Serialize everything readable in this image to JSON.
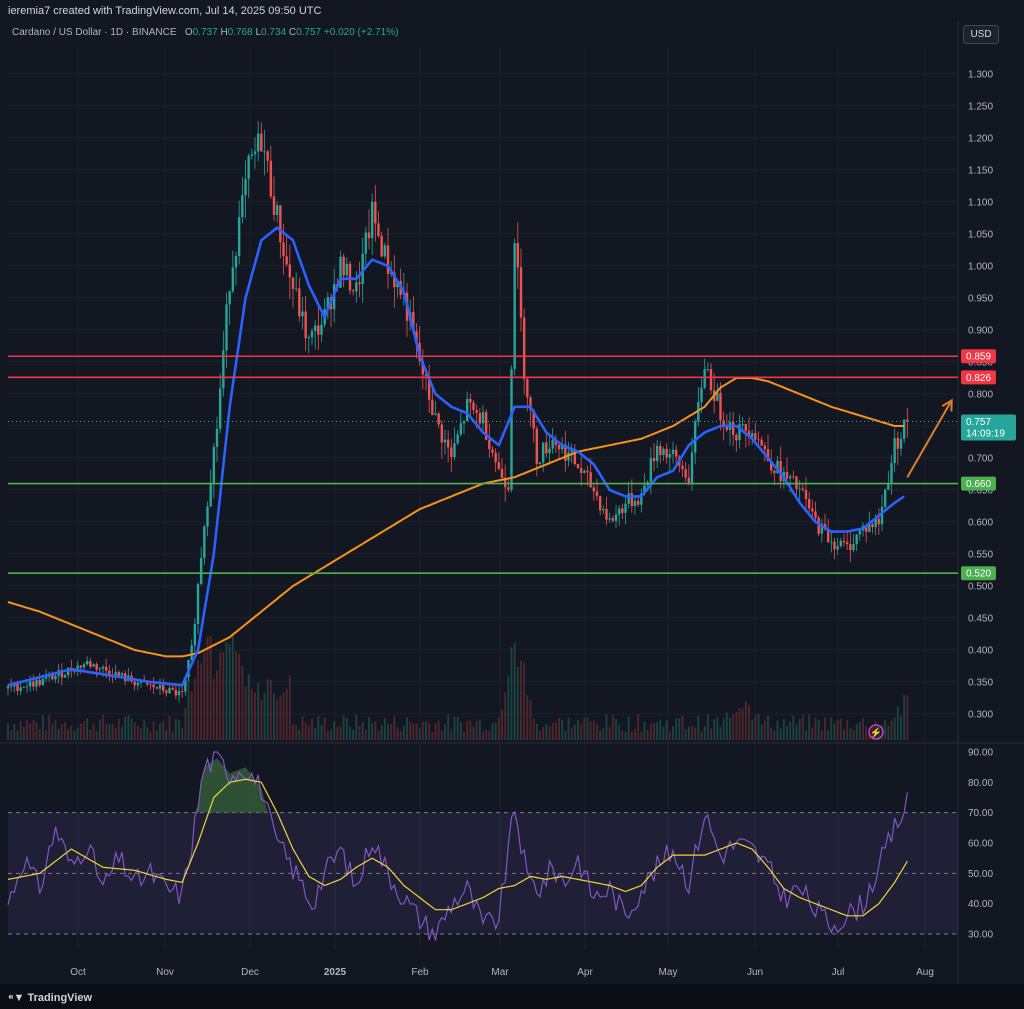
{
  "header": {
    "credit": "ieremia7 created with TradingView.com, Jul 14, 2025 09:50 UTC"
  },
  "legend": {
    "symbol": "Cardano / US Dollar · 1D · BINANCE",
    "open_label": "O",
    "open": "0.737",
    "high_label": "H",
    "high": "0.768",
    "low_label": "L",
    "low": "0.734",
    "close_label": "C",
    "close": "0.757",
    "change": "+0.020 (+2.71%)"
  },
  "currency_button": "USD",
  "footer": {
    "brand": "TradingView"
  },
  "colors": {
    "background": "#131722",
    "up": "#26a69a",
    "down": "#ef5350",
    "ema_fast": "#2962ff",
    "ema_slow": "#f7931a",
    "resistance": "#f23645",
    "support": "#4caf50",
    "rsi": "#7e57c2",
    "rsi_ma": "#f0d43a",
    "arrow": "#d9822b"
  },
  "chart_data": [
    {
      "type": "candlestick",
      "title": "Cardano / US Dollar · 1D · BINANCE",
      "x_labels": [
        "Oct",
        "Nov",
        "Dec",
        "2025",
        "Feb",
        "Mar",
        "Apr",
        "May",
        "Jun",
        "Jul",
        "Aug"
      ],
      "y_ticks": [
        "0.300",
        "0.350",
        "0.400",
        "0.450",
        "0.500",
        "0.550",
        "0.600",
        "0.650",
        "0.700",
        "0.750",
        "0.800",
        "0.850",
        "0.900",
        "0.950",
        "1.000",
        "1.050",
        "1.100",
        "1.150",
        "1.200",
        "1.250",
        "1.300"
      ],
      "ylim": [
        0.27,
        1.33
      ],
      "price_anchors": [
        [
          0,
          0.34
        ],
        [
          10,
          0.35
        ],
        [
          25,
          0.38
        ],
        [
          40,
          0.35
        ],
        [
          55,
          0.33
        ],
        [
          58,
          0.4
        ],
        [
          62,
          0.6
        ],
        [
          66,
          0.75
        ],
        [
          70,
          0.98
        ],
        [
          76,
          1.15
        ],
        [
          80,
          1.2
        ],
        [
          84,
          1.1
        ],
        [
          88,
          1.0
        ],
        [
          95,
          0.88
        ],
        [
          100,
          0.92
        ],
        [
          105,
          1.0
        ],
        [
          110,
          0.96
        ],
        [
          115,
          1.08
        ],
        [
          120,
          1.0
        ],
        [
          125,
          0.95
        ],
        [
          130,
          0.85
        ],
        [
          135,
          0.76
        ],
        [
          140,
          0.7
        ],
        [
          145,
          0.78
        ],
        [
          150,
          0.76
        ],
        [
          155,
          0.68
        ],
        [
          158,
          0.66
        ],
        [
          160,
          1.05
        ],
        [
          163,
          0.84
        ],
        [
          167,
          0.7
        ],
        [
          172,
          0.73
        ],
        [
          178,
          0.7
        ],
        [
          185,
          0.65
        ],
        [
          190,
          0.6
        ],
        [
          195,
          0.63
        ],
        [
          200,
          0.64
        ],
        [
          205,
          0.72
        ],
        [
          210,
          0.7
        ],
        [
          215,
          0.67
        ],
        [
          220,
          0.85
        ],
        [
          225,
          0.77
        ],
        [
          230,
          0.74
        ],
        [
          235,
          0.75
        ],
        [
          240,
          0.7
        ],
        [
          245,
          0.67
        ],
        [
          250,
          0.65
        ],
        [
          255,
          0.6
        ],
        [
          260,
          0.57
        ],
        [
          265,
          0.56
        ],
        [
          270,
          0.59
        ],
        [
          275,
          0.6
        ],
        [
          280,
          0.72
        ],
        [
          284,
          0.757
        ]
      ],
      "ema_fast_anchors": [
        [
          0,
          0.345
        ],
        [
          20,
          0.37
        ],
        [
          45,
          0.35
        ],
        [
          55,
          0.345
        ],
        [
          60,
          0.4
        ],
        [
          65,
          0.55
        ],
        [
          70,
          0.78
        ],
        [
          75,
          0.95
        ],
        [
          80,
          1.04
        ],
        [
          85,
          1.06
        ],
        [
          90,
          1.04
        ],
        [
          95,
          0.97
        ],
        [
          100,
          0.92
        ],
        [
          105,
          0.98
        ],
        [
          110,
          0.98
        ],
        [
          115,
          1.01
        ],
        [
          120,
          1.0
        ],
        [
          125,
          0.96
        ],
        [
          130,
          0.86
        ],
        [
          135,
          0.8
        ],
        [
          140,
          0.78
        ],
        [
          145,
          0.77
        ],
        [
          150,
          0.74
        ],
        [
          155,
          0.72
        ],
        [
          160,
          0.78
        ],
        [
          165,
          0.78
        ],
        [
          170,
          0.74
        ],
        [
          175,
          0.72
        ],
        [
          180,
          0.71
        ],
        [
          185,
          0.69
        ],
        [
          190,
          0.65
        ],
        [
          195,
          0.64
        ],
        [
          200,
          0.64
        ],
        [
          205,
          0.67
        ],
        [
          210,
          0.68
        ],
        [
          215,
          0.72
        ],
        [
          220,
          0.74
        ],
        [
          225,
          0.75
        ],
        [
          230,
          0.75
        ],
        [
          235,
          0.73
        ],
        [
          240,
          0.7
        ],
        [
          245,
          0.67
        ],
        [
          250,
          0.63
        ],
        [
          255,
          0.6
        ],
        [
          260,
          0.585
        ],
        [
          265,
          0.585
        ],
        [
          270,
          0.59
        ],
        [
          275,
          0.61
        ],
        [
          280,
          0.63
        ],
        [
          283,
          0.64
        ]
      ],
      "ema_slow_anchors": [
        [
          0,
          0.475
        ],
        [
          10,
          0.46
        ],
        [
          20,
          0.44
        ],
        [
          30,
          0.42
        ],
        [
          40,
          0.4
        ],
        [
          50,
          0.39
        ],
        [
          55,
          0.39
        ],
        [
          60,
          0.395
        ],
        [
          70,
          0.42
        ],
        [
          80,
          0.46
        ],
        [
          90,
          0.5
        ],
        [
          100,
          0.53
        ],
        [
          110,
          0.56
        ],
        [
          120,
          0.59
        ],
        [
          130,
          0.62
        ],
        [
          140,
          0.64
        ],
        [
          150,
          0.66
        ],
        [
          160,
          0.67
        ],
        [
          170,
          0.69
        ],
        [
          180,
          0.71
        ],
        [
          190,
          0.72
        ],
        [
          200,
          0.73
        ],
        [
          210,
          0.75
        ],
        [
          220,
          0.78
        ],
        [
          225,
          0.81
        ],
        [
          230,
          0.825
        ],
        [
          235,
          0.825
        ],
        [
          240,
          0.82
        ],
        [
          250,
          0.8
        ],
        [
          260,
          0.78
        ],
        [
          270,
          0.765
        ],
        [
          280,
          0.75
        ],
        [
          283,
          0.75
        ]
      ],
      "levels": [
        {
          "value": 0.859,
          "label": "0.859",
          "color": "#f23645"
        },
        {
          "value": 0.826,
          "label": "0.826",
          "color": "#f23645"
        },
        {
          "value": 0.66,
          "label": "0.660",
          "color": "#4caf50"
        },
        {
          "value": 0.52,
          "label": "0.520",
          "color": "#4caf50"
        }
      ],
      "last_price": {
        "value": "0.757",
        "countdown": "14:09:19"
      },
      "projection_arrow": {
        "from": [
          284,
          0.67
        ],
        "to": [
          298,
          0.79
        ]
      },
      "volume_spikes": [
        [
          62,
          0.55
        ],
        [
          70,
          0.45
        ],
        [
          160,
          1.0
        ],
        [
          232,
          0.35
        ],
        [
          283,
          0.25
        ]
      ]
    },
    {
      "type": "line",
      "title": "",
      "y_ticks": [
        "30.00",
        "40.00",
        "50.00",
        "60.00",
        "70.00",
        "80.00",
        "90.00"
      ],
      "ylim": [
        27,
        92
      ],
      "band": [
        30,
        70
      ],
      "rsi_anchors": [
        [
          0,
          40
        ],
        [
          5,
          55
        ],
        [
          10,
          45
        ],
        [
          15,
          65
        ],
        [
          20,
          52
        ],
        [
          25,
          60
        ],
        [
          30,
          45
        ],
        [
          35,
          55
        ],
        [
          40,
          47
        ],
        [
          45,
          50
        ],
        [
          50,
          45
        ],
        [
          55,
          43
        ],
        [
          58,
          60
        ],
        [
          62,
          85
        ],
        [
          66,
          88
        ],
        [
          70,
          83
        ],
        [
          75,
          85
        ],
        [
          80,
          78
        ],
        [
          84,
          62
        ],
        [
          88,
          55
        ],
        [
          92,
          48
        ],
        [
          96,
          40
        ],
        [
          100,
          50
        ],
        [
          105,
          58
        ],
        [
          110,
          45
        ],
        [
          115,
          62
        ],
        [
          120,
          50
        ],
        [
          125,
          42
        ],
        [
          130,
          35
        ],
        [
          135,
          30
        ],
        [
          140,
          40
        ],
        [
          145,
          45
        ],
        [
          150,
          33
        ],
        [
          155,
          35
        ],
        [
          160,
          72
        ],
        [
          164,
          48
        ],
        [
          168,
          45
        ],
        [
          172,
          52
        ],
        [
          176,
          47
        ],
        [
          180,
          55
        ],
        [
          185,
          42
        ],
        [
          190,
          45
        ],
        [
          195,
          36
        ],
        [
          200,
          45
        ],
        [
          205,
          52
        ],
        [
          210,
          58
        ],
        [
          215,
          47
        ],
        [
          220,
          70
        ],
        [
          225,
          56
        ],
        [
          230,
          60
        ],
        [
          235,
          58
        ],
        [
          240,
          52
        ],
        [
          245,
          42
        ],
        [
          250,
          45
        ],
        [
          255,
          38
        ],
        [
          260,
          33
        ],
        [
          265,
          36
        ],
        [
          270,
          40
        ],
        [
          275,
          52
        ],
        [
          280,
          65
        ],
        [
          284,
          73
        ]
      ],
      "rsi_ma_anchors": [
        [
          0,
          48
        ],
        [
          10,
          50
        ],
        [
          20,
          58
        ],
        [
          30,
          52
        ],
        [
          40,
          51
        ],
        [
          50,
          48
        ],
        [
          55,
          47
        ],
        [
          60,
          60
        ],
        [
          65,
          75
        ],
        [
          70,
          80
        ],
        [
          75,
          81
        ],
        [
          80,
          80
        ],
        [
          85,
          70
        ],
        [
          90,
          58
        ],
        [
          95,
          49
        ],
        [
          100,
          46
        ],
        [
          105,
          48
        ],
        [
          110,
          52
        ],
        [
          115,
          55
        ],
        [
          120,
          52
        ],
        [
          125,
          46
        ],
        [
          130,
          42
        ],
        [
          135,
          38
        ],
        [
          140,
          38
        ],
        [
          145,
          40
        ],
        [
          150,
          42
        ],
        [
          155,
          45
        ],
        [
          160,
          46
        ],
        [
          165,
          49
        ],
        [
          170,
          48
        ],
        [
          175,
          49
        ],
        [
          180,
          48
        ],
        [
          185,
          47
        ],
        [
          190,
          46
        ],
        [
          195,
          44
        ],
        [
          200,
          46
        ],
        [
          205,
          52
        ],
        [
          210,
          56
        ],
        [
          215,
          56
        ],
        [
          220,
          56
        ],
        [
          225,
          58
        ],
        [
          230,
          60
        ],
        [
          235,
          58
        ],
        [
          240,
          52
        ],
        [
          245,
          45
        ],
        [
          250,
          42
        ],
        [
          255,
          40
        ],
        [
          260,
          38
        ],
        [
          265,
          36
        ],
        [
          270,
          36
        ],
        [
          275,
          40
        ],
        [
          280,
          47
        ],
        [
          284,
          54
        ]
      ]
    }
  ]
}
